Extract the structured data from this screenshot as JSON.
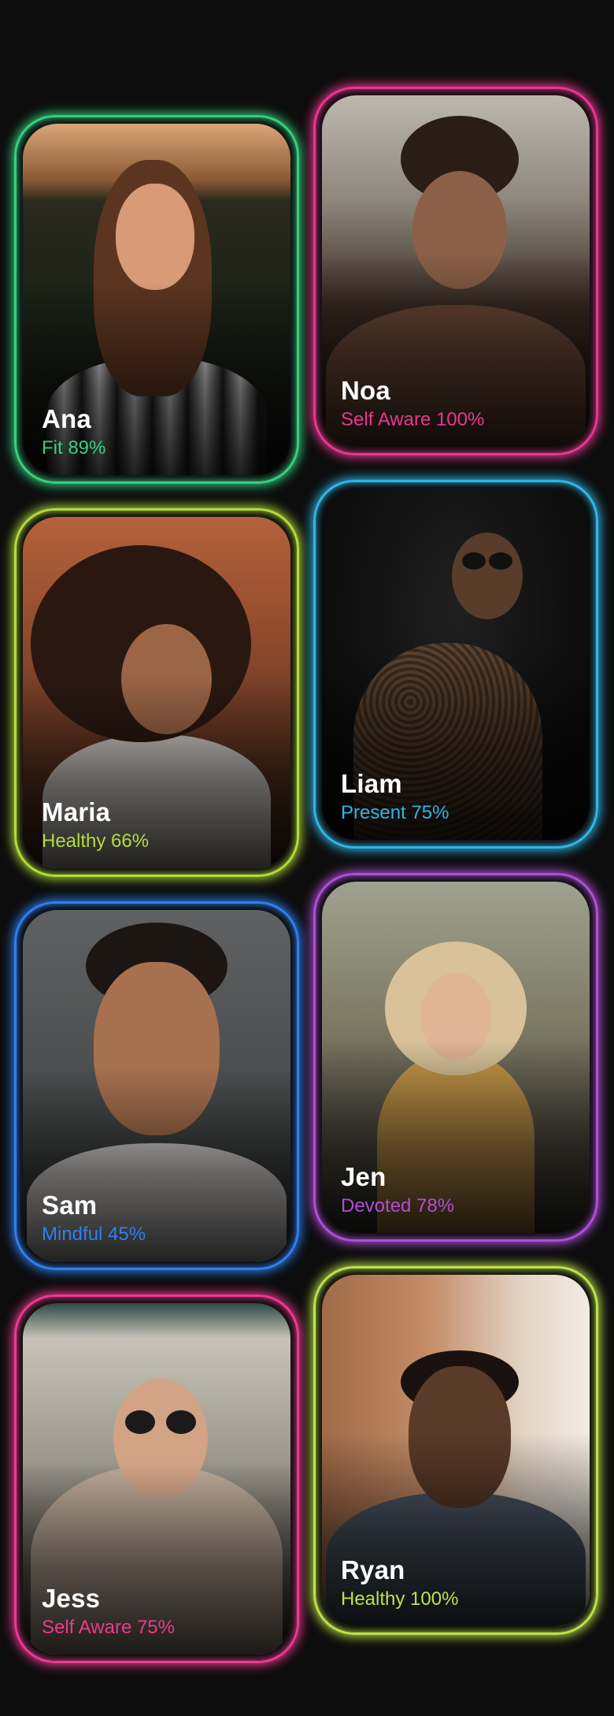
{
  "profiles": [
    {
      "name": "Ana",
      "stat": "Fit 89%",
      "accent": "#35d07f"
    },
    {
      "name": "Noa",
      "stat": "Self Aware 100%",
      "accent": "#e9368f"
    },
    {
      "name": "Maria",
      "stat": "Healthy 66%",
      "accent": "#b2dc3a"
    },
    {
      "name": "Liam",
      "stat": "Present 75%",
      "accent": "#2fb6e8"
    },
    {
      "name": "Sam",
      "stat": "Mindful 45%",
      "accent": "#2f7ff0"
    },
    {
      "name": "Jen",
      "stat": "Devoted 78%",
      "accent": "#b04ed8"
    },
    {
      "name": "Jess",
      "stat": "Self Aware 75%",
      "accent": "#ec3a8e"
    },
    {
      "name": "Ryan",
      "stat": "Healthy 100%",
      "accent": "#bde24a"
    }
  ]
}
